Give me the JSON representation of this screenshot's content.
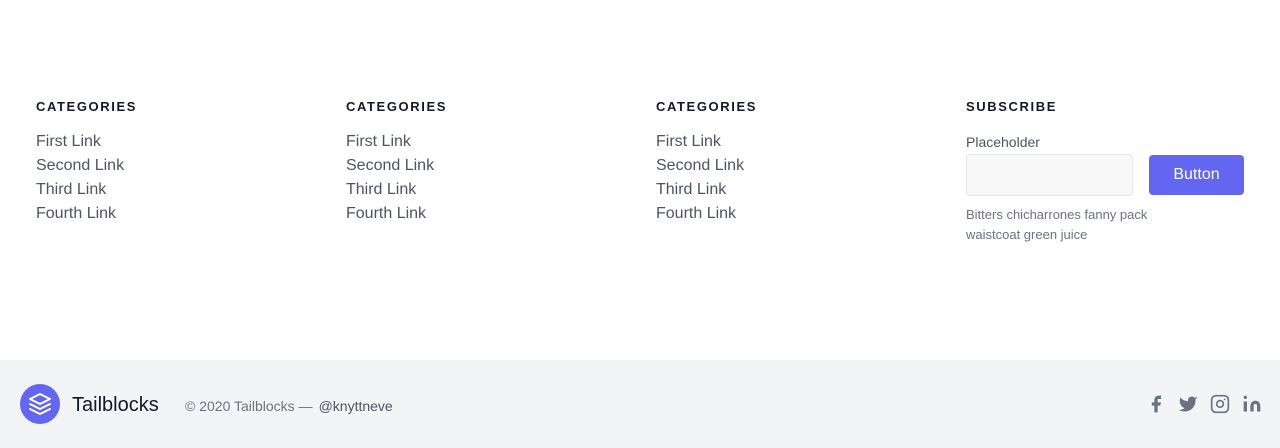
{
  "columns": [
    {
      "heading": "CATEGORIES",
      "links": [
        "First Link",
        "Second Link",
        "Third Link",
        "Fourth Link"
      ]
    },
    {
      "heading": "CATEGORIES",
      "links": [
        "First Link",
        "Second Link",
        "Third Link",
        "Fourth Link"
      ]
    },
    {
      "heading": "CATEGORIES",
      "links": [
        "First Link",
        "Second Link",
        "Third Link",
        "Fourth Link"
      ]
    }
  ],
  "subscribe": {
    "heading": "SUBSCRIBE",
    "field_label": "Placeholder",
    "input_value": "",
    "button_label": "Button",
    "help_text": "Bitters chicharrones fanny pack waistcoat green juice"
  },
  "footer": {
    "brand": "Tailblocks",
    "copyright": "© 2020 Tailblocks —",
    "handle": "@knyttneve",
    "social_icons": [
      "facebook-icon",
      "twitter-icon",
      "instagram-icon",
      "linkedin-icon"
    ]
  },
  "colors": {
    "accent": "#6366f1",
    "footer_bg": "#f3f4f6",
    "heading": "#111827",
    "text": "#4b5563"
  }
}
